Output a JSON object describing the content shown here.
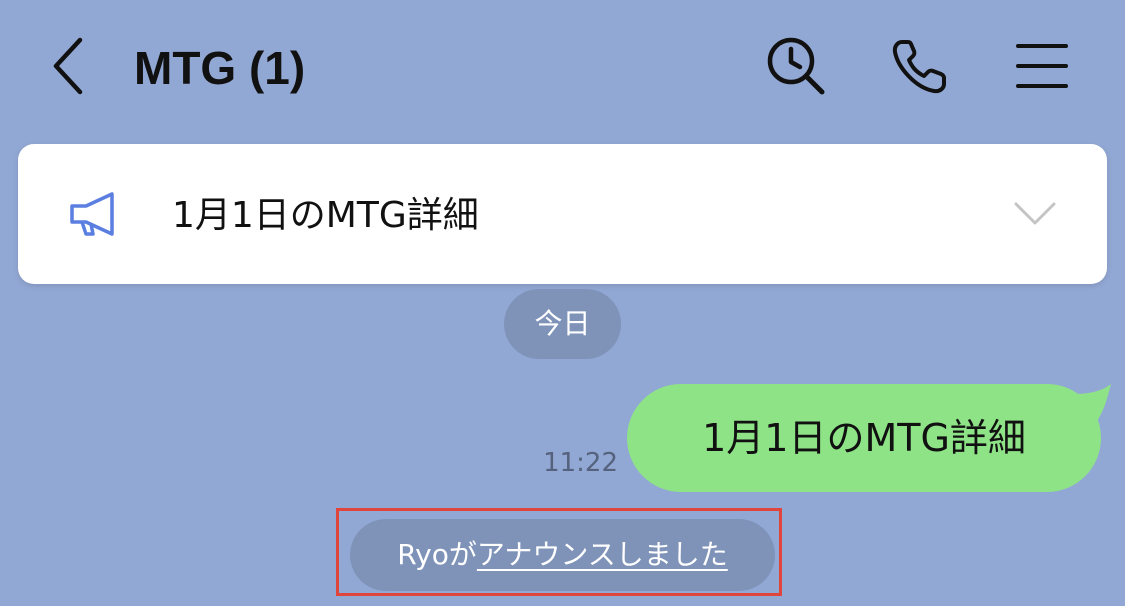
{
  "header": {
    "title": "MTG (1)",
    "back_icon": "chevron-left-icon",
    "search_icon": "search-icon",
    "phone_icon": "phone-icon",
    "menu_icon": "menu-icon"
  },
  "announcement": {
    "icon": "megaphone-icon",
    "text": "1月1日のMTG詳細",
    "expand_icon": "chevron-down-icon"
  },
  "date_separator": {
    "label": "今日"
  },
  "messages": [
    {
      "direction": "outgoing",
      "text": "1月1日のMTG詳細",
      "time": "11:22"
    }
  ],
  "system_notice": {
    "actor": "Ryo",
    "particle": "が",
    "link_text": "アナウンスしました"
  },
  "colors": {
    "background": "#92a8d4",
    "outgoing_bubble": "#8ee387",
    "pill": "#7f93b9",
    "megaphone": "#5b7fe0",
    "highlight_frame": "#e0443a"
  }
}
